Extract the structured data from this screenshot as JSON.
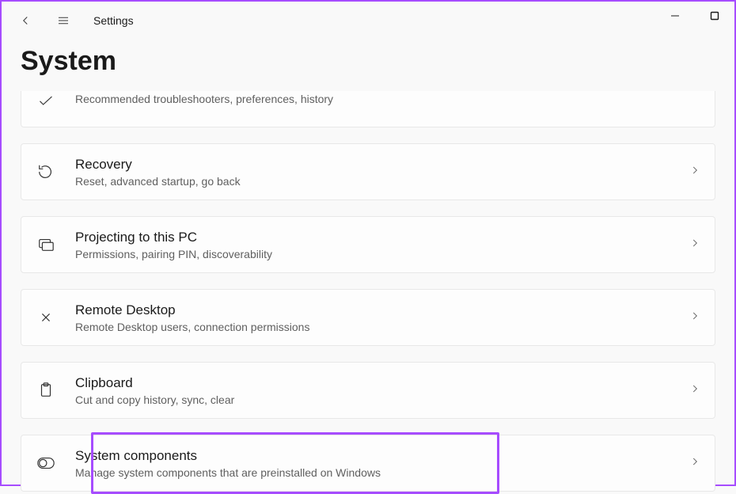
{
  "header": {
    "app_label": "Settings",
    "page_title": "System"
  },
  "items": {
    "troubleshoot": {
      "title": "",
      "subtitle": "Recommended troubleshooters, preferences, history"
    },
    "recovery": {
      "title": "Recovery",
      "subtitle": "Reset, advanced startup, go back"
    },
    "projecting": {
      "title": "Projecting to this PC",
      "subtitle": "Permissions, pairing PIN, discoverability"
    },
    "remote": {
      "title": "Remote Desktop",
      "subtitle": "Remote Desktop users, connection permissions"
    },
    "clipboard": {
      "title": "Clipboard",
      "subtitle": "Cut and copy history, sync, clear"
    },
    "syscomp": {
      "title": "System components",
      "subtitle": "Manage system components that are preinstalled on Windows"
    }
  }
}
